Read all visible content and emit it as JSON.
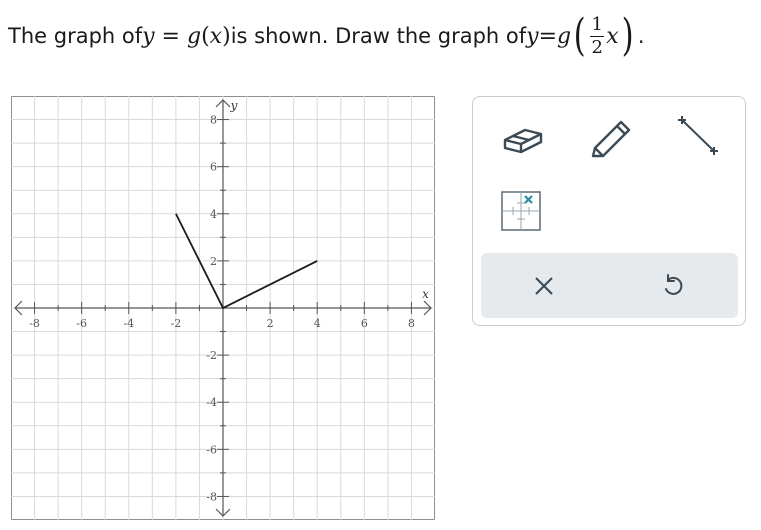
{
  "question": {
    "text_before": "The graph of ",
    "y1": "y",
    "eq1": " = ",
    "g1": "g",
    "arg1_open": "(",
    "arg1_var": "x",
    "arg1_close": ")",
    "text_middle": " is shown. Draw the graph of ",
    "y2": "y",
    "eq2": " = ",
    "g2": "g",
    "frac_num": "1",
    "frac_den": "2",
    "arg2_var": "x",
    "paren_open": "(",
    "paren_close": ")",
    "period": "."
  },
  "graph": {
    "x_axis_label": "x",
    "y_axis_label": "y",
    "x_range": [
      -9,
      9
    ],
    "y_range": [
      -9,
      9
    ],
    "x_tick_labels": [
      "-8",
      "-6",
      "-4",
      "-2",
      "2",
      "4",
      "6",
      "8"
    ],
    "y_tick_labels": [
      "8",
      "6",
      "4",
      "2",
      "-2",
      "-4",
      "-6",
      "-8"
    ],
    "grid": true,
    "line_color": "#1a1a1a",
    "grid_color": "#d9d9d9",
    "function_points": [
      [
        -2,
        4
      ],
      [
        0,
        0
      ],
      [
        4,
        2
      ]
    ]
  },
  "tools": {
    "eraser": "eraser-icon",
    "pencil": "pencil-icon",
    "segment": "line-segment-icon",
    "point": "point-on-grid-icon",
    "clear": "clear-x-icon",
    "undo": "undo-icon",
    "accent_color": "#2a8fa0",
    "icon_color": "#3b4a55"
  }
}
